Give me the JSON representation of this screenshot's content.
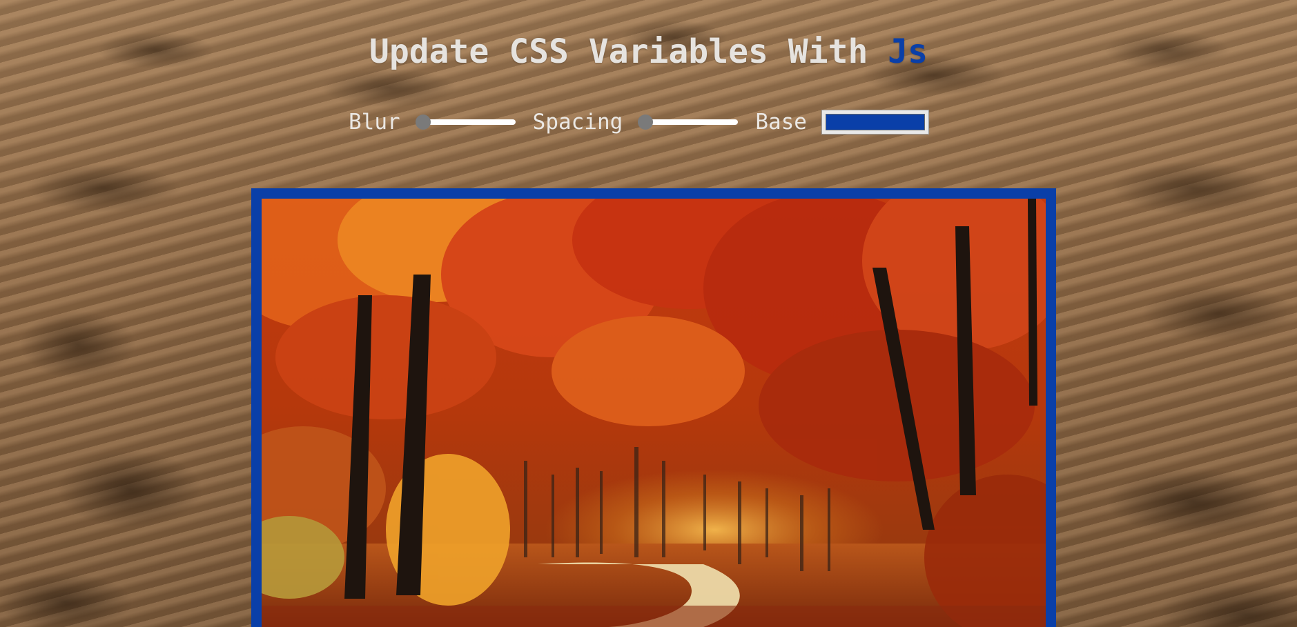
{
  "header": {
    "title_text": "Update CSS Variables With ",
    "title_highlight": "Js"
  },
  "controls": {
    "blur": {
      "label": "Blur",
      "value": 0
    },
    "spacing": {
      "label": "Spacing",
      "value": 0
    },
    "base": {
      "label": "Base",
      "value": "#0a3fa8"
    }
  },
  "colors": {
    "accent": "#0a3fa8",
    "title": "#e6e3df"
  }
}
